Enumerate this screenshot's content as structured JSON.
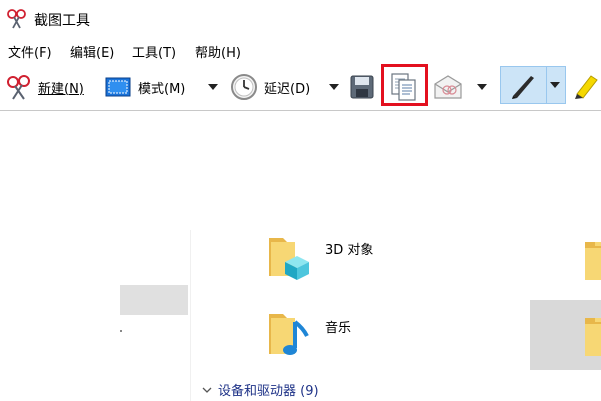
{
  "window": {
    "title": "截图工具"
  },
  "menu": [
    "文件(F)",
    "编辑(E)",
    "工具(T)",
    "帮助(H)"
  ],
  "toolbar": {
    "new_label": "新建(N)",
    "mode_label": "模式(M)",
    "delay_label": "延迟(D)"
  },
  "tooltip": {
    "text": "复制"
  },
  "explorer": {
    "items": [
      {
        "label": "3D 对象",
        "icon": "3d-objects-folder-icon"
      },
      {
        "label": "音乐",
        "icon": "music-folder-icon"
      }
    ],
    "group_header": "设备和驱动器 (9)"
  },
  "colors": {
    "highlight_border": "#e3101f",
    "pen_group_bg": "#cce4f7",
    "group_header_text": "#1e3287"
  }
}
